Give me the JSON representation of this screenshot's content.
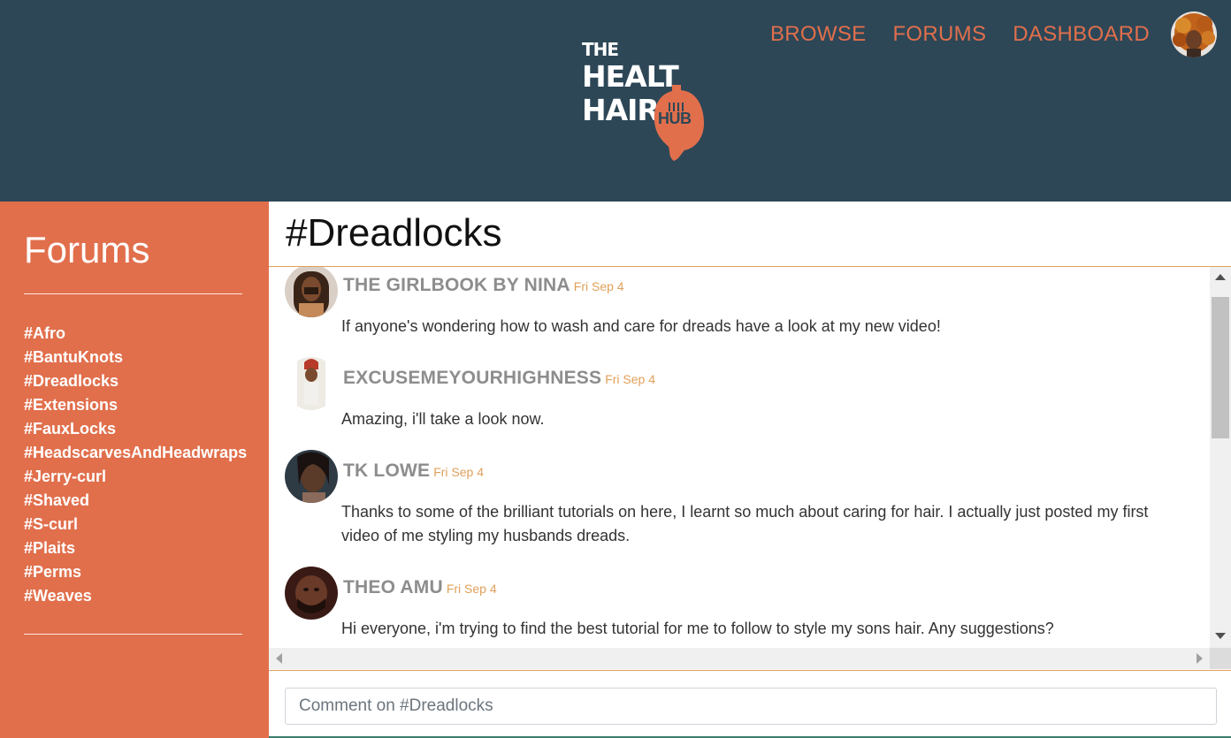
{
  "brand": {
    "logo_line1": "THE",
    "logo_line2": "HEALT",
    "logo_line3": "HAIR",
    "logo_hub": "HUB"
  },
  "colors": {
    "header_bg": "#2d4757",
    "accent": "#e16f4c",
    "date": "#e0a05a",
    "username": "#8d8d8d"
  },
  "nav": {
    "items": [
      {
        "label": "BROWSE"
      },
      {
        "label": "FORUMS"
      },
      {
        "label": "DASHBOARD"
      }
    ],
    "avatar_icon": "user-avatar"
  },
  "sidebar": {
    "title": "Forums",
    "tags": [
      "#Afro",
      "#BantuKnots",
      "#Dreadlocks",
      "#Extensions",
      "#FauxLocks",
      "#HeadscarvesAndHeadwraps",
      "#Jerry-curl",
      "#Shaved",
      "#S-curl",
      "#Plaits",
      "#Perms",
      "#Weaves"
    ]
  },
  "forum": {
    "title": "#Dreadlocks",
    "posts": [
      {
        "user": "THE GIRLBOOK BY NINA",
        "date": "Fri Sep 4",
        "text": "If anyone's wondering how to wash and care for dreads have a look at my new video!"
      },
      {
        "user": "EXCUSEMEYOURHIGHNESS",
        "date": "Fri Sep 4",
        "text": "Amazing, i'll take a look now."
      },
      {
        "user": "TK LOWE",
        "date": "Fri Sep 4",
        "text": "Thanks to some of the brilliant tutorials on here, I learnt so much about caring for hair. I actually just posted my first video of me styling my husbands dreads."
      },
      {
        "user": "THEO AMU",
        "date": "Fri Sep 4",
        "text": "Hi everyone, i'm trying to find the best tutorial for me to follow to style my sons hair. Any suggestions?"
      }
    ],
    "comment_placeholder": "Comment on #Dreadlocks"
  }
}
